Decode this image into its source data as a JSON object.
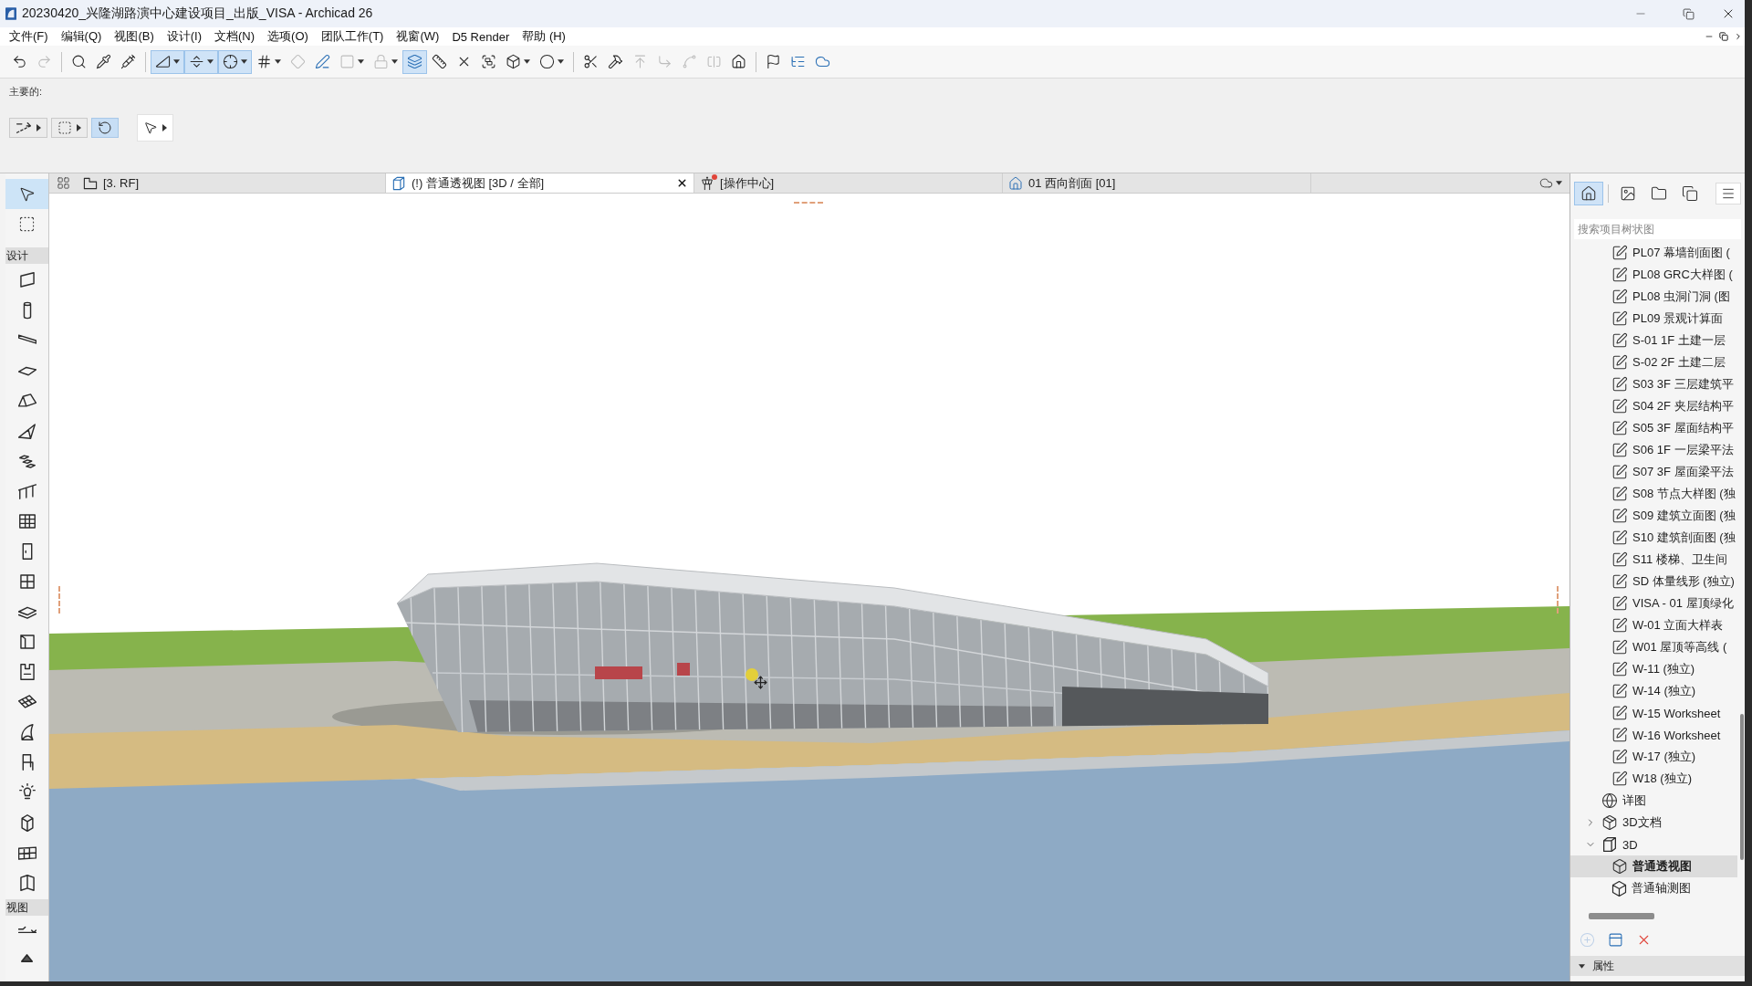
{
  "window": {
    "title": "20230420_兴隆湖路演中心建设项目_出版_VISA - Archicad 26"
  },
  "menu": [
    "文件(F)",
    "编辑(Q)",
    "视图(B)",
    "设计(I)",
    "文档(N)",
    "选项(O)",
    "团队工作(T)",
    "视窗(W)",
    "D5 Render",
    "帮助 (H)"
  ],
  "toolbar": [
    [
      {
        "selected": false,
        "disabled": false,
        "dropdown": false
      },
      {
        "selected": false,
        "disabled": true,
        "dropdown": false
      }
    ],
    [
      {
        "selected": false,
        "disabled": false,
        "dropdown": false
      },
      {
        "selected": false,
        "disabled": false,
        "dropdown": false
      },
      {
        "selected": false,
        "disabled": false,
        "dropdown": false
      }
    ],
    [
      {
        "selected": true,
        "disabled": false,
        "dropdown": true
      },
      {
        "selected": true,
        "disabled": false,
        "dropdown": true
      },
      {
        "selected": true,
        "disabled": false,
        "dropdown": true
      },
      {
        "selected": false,
        "disabled": false,
        "dropdown": true
      },
      {
        "selected": false,
        "disabled": true,
        "dropdown": false
      },
      {
        "selected": false,
        "disabled": false,
        "dropdown": false
      },
      {
        "selected": false,
        "disabled": true,
        "dropdown": true
      },
      {
        "selected": false,
        "disabled": true,
        "dropdown": true
      },
      {
        "selected": true,
        "disabled": false,
        "dropdown": false
      },
      {
        "selected": false,
        "disabled": false,
        "dropdown": false
      },
      {
        "selected": false,
        "disabled": false,
        "dropdown": false
      },
      {
        "selected": false,
        "disabled": false,
        "dropdown": false
      },
      {
        "selected": false,
        "disabled": false,
        "dropdown": true
      },
      {
        "selected": false,
        "disabled": false,
        "dropdown": true
      }
    ],
    [
      {
        "selected": false,
        "disabled": false,
        "dropdown": false
      },
      {
        "selected": false,
        "disabled": false,
        "dropdown": false
      },
      {
        "selected": false,
        "disabled": true,
        "dropdown": false
      },
      {
        "selected": false,
        "disabled": true,
        "dropdown": false
      },
      {
        "selected": false,
        "disabled": true,
        "dropdown": false
      },
      {
        "selected": false,
        "disabled": true,
        "dropdown": false
      },
      {
        "selected": false,
        "disabled": false,
        "dropdown": false
      }
    ],
    [
      {
        "selected": false,
        "disabled": false,
        "dropdown": false
      },
      {
        "selected": false,
        "disabled": false,
        "dropdown": false
      },
      {
        "selected": false,
        "disabled": false,
        "dropdown": false
      }
    ]
  ],
  "info_box": {
    "label": "主要的:",
    "controls": [
      {
        "selected": false,
        "dropdown": true
      },
      {
        "selected": false,
        "dropdown": true
      },
      {
        "selected": true,
        "dropdown": false
      },
      {
        "selected": false,
        "dropdown": true
      }
    ]
  },
  "toolbox": {
    "tools": [
      {
        "selected": true
      },
      {
        "selected": false
      }
    ],
    "sections": [
      {
        "title": "设计",
        "tools": [
          {
            "selected": false
          },
          {
            "selected": false
          },
          {
            "selected": false
          },
          {
            "selected": false
          },
          {
            "selected": false
          },
          {
            "selected": false
          },
          {
            "selected": false
          },
          {
            "selected": false
          },
          {
            "selected": false
          },
          {
            "selected": false
          },
          {
            "selected": false
          },
          {
            "selected": false
          },
          {
            "selected": false
          },
          {
            "selected": false
          },
          {
            "selected": false
          },
          {
            "selected": false
          },
          {
            "selected": false
          },
          {
            "selected": false
          },
          {
            "selected": false
          },
          {
            "selected": false
          },
          {
            "selected": false
          }
        ]
      },
      {
        "title": "视图",
        "tools": [
          {
            "selected": false
          },
          {
            "selected": false
          }
        ]
      }
    ]
  },
  "tabs": [
    {
      "kind": "plan",
      "label": "[3. RF]",
      "selected": false,
      "alert": false
    },
    {
      "kind": "perspective",
      "label": "(!) 普通透视图 [3D / 全部]",
      "selected": true,
      "alert": false
    },
    {
      "kind": "center",
      "label": "[操作中心]",
      "selected": false,
      "alert": true
    },
    {
      "kind": "section",
      "label": "01 西向剖面 [01]",
      "selected": false,
      "alert": false
    }
  ],
  "navigator": {
    "views": [
      {
        "selected": true
      },
      {
        "selected": false
      },
      {
        "selected": false
      },
      {
        "selected": false
      }
    ],
    "search": {
      "placeholder": "搜索项目树状图"
    },
    "tree": {
      "continued": [
        {
          "kind": "worksheet",
          "label": "PL07 幕墙剖面图 (",
          "selected": false
        },
        {
          "kind": "worksheet",
          "label": "PL08 GRC大样图 (",
          "selected": false
        },
        {
          "kind": "worksheet",
          "label": "PL08 虫洞门洞 (图",
          "selected": false
        },
        {
          "kind": "worksheet",
          "label": "PL09 景观计算面",
          "selected": false
        },
        {
          "kind": "worksheet",
          "label": "S-01 1F 土建一层",
          "selected": false
        },
        {
          "kind": "worksheet",
          "label": "S-02 2F 土建二层",
          "selected": false
        },
        {
          "kind": "worksheet",
          "label": "S03 3F 三层建筑平",
          "selected": false
        },
        {
          "kind": "worksheet",
          "label": "S04 2F 夹层结构平",
          "selected": false
        },
        {
          "kind": "worksheet",
          "label": "S05 3F 屋面结构平",
          "selected": false
        },
        {
          "kind": "worksheet",
          "label": "S06 1F 一层梁平法",
          "selected": false
        },
        {
          "kind": "worksheet",
          "label": "S07 3F 屋面梁平法",
          "selected": false
        },
        {
          "kind": "worksheet",
          "label": "S08 节点大样图 (独",
          "selected": false
        },
        {
          "kind": "worksheet",
          "label": "S09 建筑立面图 (独",
          "selected": false
        },
        {
          "kind": "worksheet",
          "label": "S10 建筑剖面图 (独",
          "selected": false
        },
        {
          "kind": "worksheet",
          "label": "S11 楼梯、卫生间",
          "selected": false
        },
        {
          "kind": "worksheet",
          "label": "SD 体量线形 (独立)",
          "selected": false
        },
        {
          "kind": "worksheet",
          "label": "VISA - 01 屋顶绿化",
          "selected": false
        },
        {
          "kind": "worksheet",
          "label": "W-01  立面大样表",
          "selected": false
        },
        {
          "kind": "worksheet",
          "label": "W01 屋顶等高线 (",
          "selected": false
        },
        {
          "kind": "worksheet",
          "label": "W-11 (独立)",
          "selected": false
        },
        {
          "kind": "worksheet",
          "label": "W-14 (独立)",
          "selected": false
        },
        {
          "kind": "worksheet",
          "label": "W-15 Worksheet",
          "selected": false
        },
        {
          "kind": "worksheet",
          "label": "W-16 Worksheet",
          "selected": false
        },
        {
          "kind": "worksheet",
          "label": "W-17 (独立)",
          "selected": false
        },
        {
          "kind": "worksheet",
          "label": "W18 (独立)",
          "selected": false
        }
      ],
      "items": [
        {
          "kind": "detail",
          "label": "详图",
          "selected": false
        },
        {
          "kind": "documents",
          "label": "3D文档",
          "selected": false,
          "expanded": false
        },
        {
          "kind": "folder",
          "label": "3D",
          "selected": false,
          "expanded": true,
          "children": [
            {
              "kind": "perspective",
              "label": "普通透视图",
              "selected": true
            },
            {
              "kind": "axonometric",
              "label": "普通轴测图",
              "selected": false
            }
          ]
        }
      ]
    },
    "actions": [
      {
        "disabled": true
      },
      {
        "disabled": false
      },
      {
        "disabled": false
      }
    ],
    "properties": {
      "label": "属性"
    }
  }
}
